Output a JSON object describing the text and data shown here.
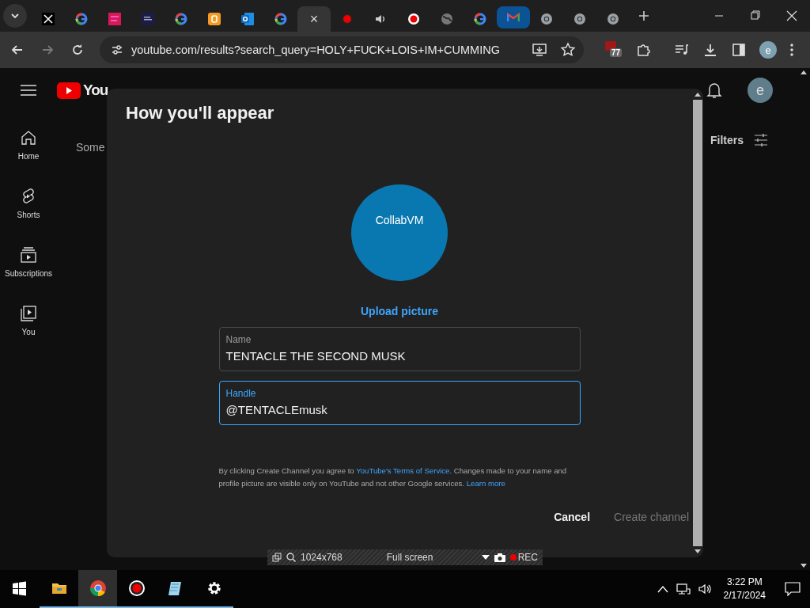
{
  "browser": {
    "tabs": [
      {
        "kind": "x",
        "selected": false,
        "hovered": false
      },
      {
        "kind": "google",
        "selected": false,
        "hovered": false
      },
      {
        "kind": "pink",
        "selected": false,
        "hovered": false
      },
      {
        "kind": "navy",
        "selected": false,
        "hovered": false
      },
      {
        "kind": "google",
        "selected": false,
        "hovered": false
      },
      {
        "kind": "blogger",
        "selected": false,
        "hovered": false
      },
      {
        "kind": "outlook",
        "selected": false,
        "hovered": false
      },
      {
        "kind": "google",
        "selected": false,
        "hovered": false
      },
      {
        "kind": "blank",
        "selected": true,
        "hovered": false,
        "close": "×"
      },
      {
        "kind": "recdot",
        "selected": false,
        "hovered": false
      },
      {
        "kind": "speaker",
        "selected": false,
        "hovered": false
      },
      {
        "kind": "record",
        "selected": false,
        "hovered": false
      },
      {
        "kind": "globe",
        "selected": false,
        "hovered": false
      },
      {
        "kind": "google",
        "selected": false,
        "hovered": false
      },
      {
        "kind": "gmail",
        "selected": false,
        "hovered": true
      },
      {
        "kind": "chrome",
        "selected": false,
        "hovered": false
      },
      {
        "kind": "chrome",
        "selected": false,
        "hovered": false
      },
      {
        "kind": "chrome",
        "selected": false,
        "hovered": false
      }
    ],
    "url": "youtube.com/results?search_query=HOLY+FUCK+LOIS+IM+CUMMING",
    "extension_badge": "77",
    "profile_initial": "e"
  },
  "youtube": {
    "logo": "You",
    "sidebar": [
      {
        "kind": "home",
        "label": "Home"
      },
      {
        "kind": "shorts",
        "label": "Shorts"
      },
      {
        "kind": "subscriptions",
        "label": "Subscriptions"
      },
      {
        "kind": "you",
        "label": "You"
      }
    ],
    "partial_text": "Some",
    "filters": "Filters",
    "avatar_initial": "e"
  },
  "dialog": {
    "title": "How you'll appear",
    "avatar_text": "CollabVM",
    "upload": "Upload picture",
    "fields": [
      {
        "label": "Name",
        "value": "TENTACLE THE SECOND MUSK",
        "focused": false
      },
      {
        "label": "Handle",
        "value": "@TENTACLEmusk",
        "focused": true
      }
    ],
    "legal": "By clicking Create Channel you agree to ",
    "legal_link": "YouTube's Terms of Service",
    "legal_rest": ". Changes made to your name and profile picture are visible only on YouTube and not other Google services. ",
    "learn_more": "Learn more",
    "buttons": [
      {
        "label": "Cancel",
        "disabled": false
      },
      {
        "label": "Create channel",
        "disabled": true
      }
    ]
  },
  "recorder": {
    "resolution": "1024x768",
    "mode": "Full screen",
    "rec": "REC"
  },
  "taskbar": {
    "apps": [
      {
        "kind": "folder",
        "selected": false
      },
      {
        "kind": "chrome",
        "selected": true
      },
      {
        "kind": "record",
        "selected": false
      },
      {
        "kind": "notepad",
        "selected": false
      },
      {
        "kind": "gear",
        "selected": false
      }
    ],
    "time": "3:22 PM",
    "date": "2/17/2024"
  }
}
